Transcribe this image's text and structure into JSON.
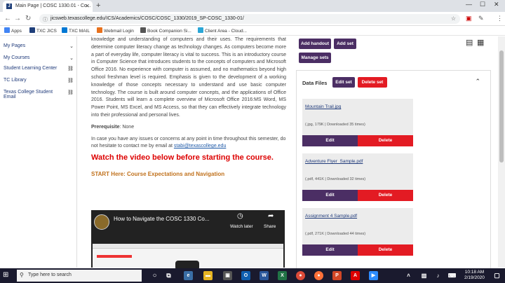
{
  "browser": {
    "tab_title": "Main Page | COSC 1330.01 - Co...",
    "tab_fav": "J",
    "url": "jicsweb.texascollege.edu/ICS/Academics/COSC/COSC_1330/2019_SP-COSC_1330-01/",
    "bookmarks": [
      {
        "label": "Apps",
        "color": "#4285f4"
      },
      {
        "label": "TXC JICS",
        "color": "#1f3f7a"
      },
      {
        "label": "TXC MAIL",
        "color": "#0078d4"
      },
      {
        "label": "Webmail Login",
        "color": "#e8711c"
      },
      {
        "label": "Book Companion Si...",
        "color": "#555555"
      },
      {
        "label": "Client Area - Cloud...",
        "color": "#2aa6d6"
      }
    ]
  },
  "sidebar": {
    "items": [
      {
        "label": "My Pages",
        "arrow": "⌄"
      },
      {
        "label": "My Courses",
        "arrow": "⌄"
      },
      {
        "label": "Student Learning Center",
        "arrow": "⛓"
      },
      {
        "label": "TC Library",
        "arrow": "⛓"
      },
      {
        "label": "Texas College Student Email",
        "arrow": "⛓"
      }
    ]
  },
  "main": {
    "description": "knowledge and understanding of computers and their uses. The requirements that determine computer literacy change as technology changes. As computers become more a part of everyday life, computer literacy is vital to success. This is an introductory course in Computer Science that introduces students to the concepts of computers and Microsoft Office 2016. No experience with computer is assumed, and no mathematics beyond high school freshman level is required. Emphasis is given to the development of a working knowledge of those concepts necessary to understand and use basic computer technology. The course is built around computer concepts, and the applications of Office 2016. Students will learn a complete overview of Microsoft Office 2016:MS Word, MS Power Point, MS Excel, and MS Access, so that they can effectively integrate technology into their professional and personal lives.",
    "prereq_label": "Prerequisite",
    "prereq_value": ": None",
    "note_text": "In case you have any issues or concerns at any point in time throughout this semester, do not hesitate to contact me by email at ",
    "email": "stabi@texascollege.edu",
    "watch_heading": "Watch the video below before starting the course.",
    "start_heading": "START Here: Course Expectations and Navigation",
    "video": {
      "title": "How to Navigate the COSC 1330 Co...",
      "watch_later": "Watch later",
      "share": "Share"
    }
  },
  "rightpanel": {
    "add_handout": "Add handout",
    "add_set": "Add set",
    "manage_sets": "Manage sets",
    "data_files_title": "Data Files",
    "edit_set": "Edit set",
    "delete_set": "Delete set",
    "files": [
      {
        "name": "Mountain Trail.jpg",
        "info": "(.jpg, 179K | Downloaded 35 times)",
        "edit": "Edit",
        "delete": "Delete"
      },
      {
        "name": "Adventure Flyer_Sample.pdf",
        "info": "(.pdf, 441K | Downloaded 32 times)",
        "edit": "Edit",
        "delete": "Delete"
      },
      {
        "name": "Assignment 4 Sample.pdf",
        "info": "(.pdf, 271K | Downloaded 44 times)",
        "edit": "Edit",
        "delete": "Delete"
      }
    ]
  },
  "taskbar": {
    "search_placeholder": "Type here to search",
    "time": "10:18 AM",
    "date": "2/19/2020"
  }
}
